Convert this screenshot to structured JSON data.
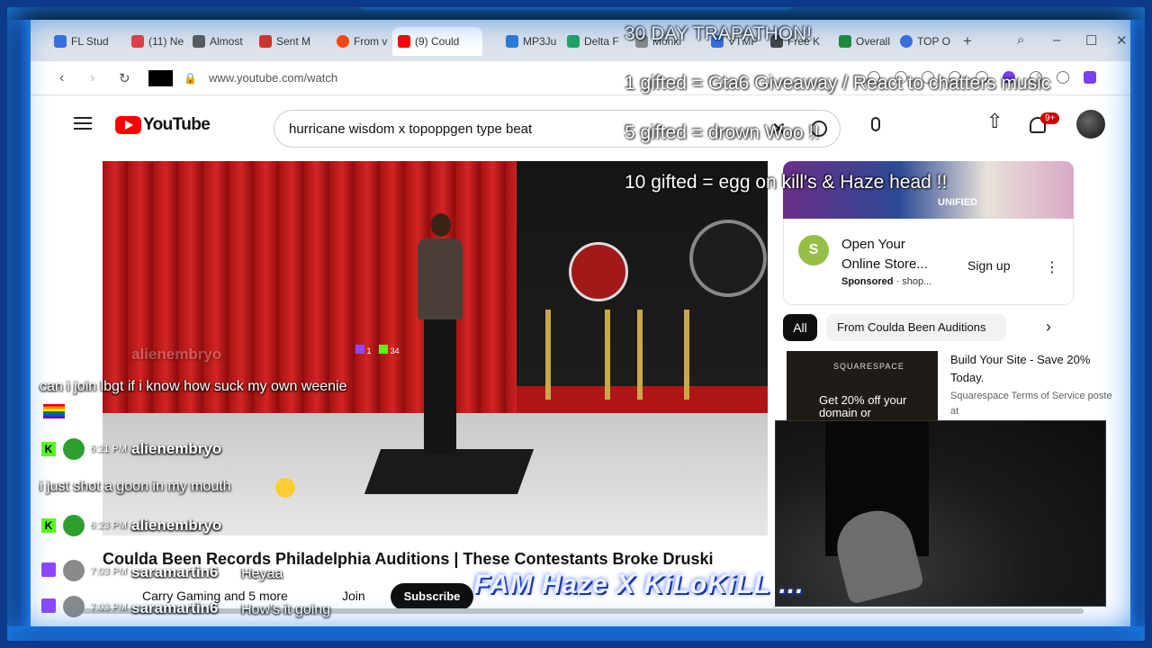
{
  "browser": {
    "tabs": [
      {
        "label": "FL Stud",
        "color": "#3a6fd8"
      },
      {
        "label": "(11) Ne",
        "color": "#e04040"
      },
      {
        "label": "Almost",
        "color": "#5a5a5a"
      },
      {
        "label": "Sent M",
        "color": "#d93025"
      },
      {
        "label": "From v",
        "color": "#ff4500"
      },
      {
        "label": "(9) Could",
        "color": "#ff0000"
      },
      {
        "label": "MP3Ju",
        "color": "#2a7ad8"
      },
      {
        "label": "Delta F",
        "color": "#1ea362"
      },
      {
        "label": "Monki",
        "color": "#888888"
      },
      {
        "label": "VTMP",
        "color": "#3a6fd8"
      },
      {
        "label": "Free K",
        "color": "#444444"
      },
      {
        "label": "Overall",
        "color": "#1f8a3a"
      },
      {
        "label": "TOP O",
        "color": "#3a6fd8"
      }
    ],
    "url": "www.youtube.com/watch"
  },
  "youtube": {
    "logo_text": "YouTube",
    "search_query": "hurricane wisdom x topoppgen type beat",
    "notification_count": "9+",
    "video_title": "Coulda Been Records Philadelphia Auditions | These Contestants Broke Druski",
    "channel_line": "Carry Gaming and 5 more",
    "join_label": "Join",
    "subscribe_label": "Subscribe",
    "video_badge": {
      "twitch_count": "1",
      "kick_count": "34"
    }
  },
  "sidebar": {
    "ad": {
      "title": "Open Your Online Store...",
      "sponsored": "Sponsored",
      "advertiser": "shop...",
      "cta": "Sign up",
      "thumb_text": "UNIFIED"
    },
    "chips": {
      "all": "All",
      "from": "From Coulda Been Auditions"
    },
    "video": {
      "brand": "SQUARESPACE",
      "offer": "Get 20% off your domain or",
      "title": "Build Your Site - Save 20% Today.",
      "subtitle": "Squarespace Terms of Service poste at"
    }
  },
  "overlay": {
    "goals": [
      "30 DAY TRAPATHON!",
      "1 gifted = Gta6 Giveaway / React to chatters music",
      "5 gifted = drown Woo  !!",
      "10 gifted = egg on kill's & Haze head  !!"
    ],
    "banner_text": "FAM Haze X KiLoKiLL ...",
    "chat": [
      {
        "user": "alienembryo",
        "time": "",
        "message": "can i join lbgt if i know how suck my own weenie",
        "platform": "kick"
      },
      {
        "user": "alienembryo",
        "time": "6:21 PM",
        "message": "i just shot a goon in my mouth",
        "platform": "kick"
      },
      {
        "user": "alienembryo",
        "time": "6:23 PM",
        "message": "",
        "platform": "kick"
      },
      {
        "user": "saramartin6",
        "time": "7:03 PM",
        "message": "Heyaa",
        "platform": "twitch"
      },
      {
        "user": "saramartin6",
        "time": "7:03 PM",
        "message": "How's it going",
        "platform": "twitch"
      }
    ],
    "colors": {
      "kick": "#53fc18",
      "twitch": "#9146ff"
    }
  }
}
